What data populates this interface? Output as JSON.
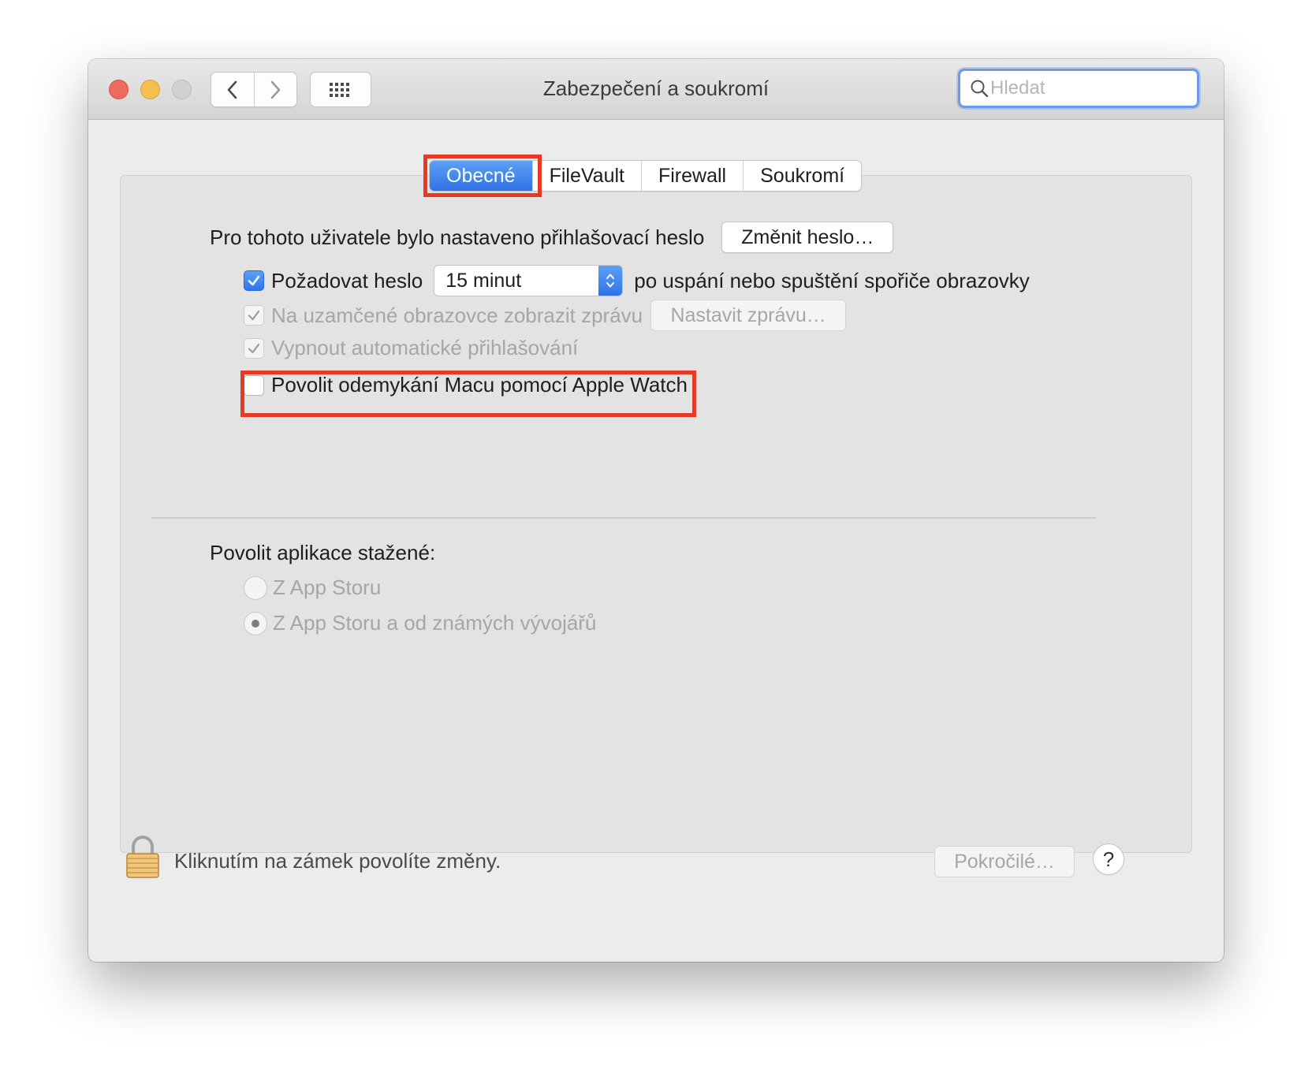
{
  "window": {
    "title": "Zabezpečení a soukromí",
    "icons": {
      "close": "close-window-icon",
      "minimize": "minimize-window-icon",
      "zoom": "zoom-window-icon",
      "back": "chevron-left-icon",
      "forward": "chevron-right-icon",
      "show_all": "grid-icon",
      "search": "search-icon"
    }
  },
  "search": {
    "placeholder": "Hledat",
    "value": ""
  },
  "tabs": [
    {
      "label": "Obecné",
      "selected": true
    },
    {
      "label": "FileVault",
      "selected": false
    },
    {
      "label": "Firewall",
      "selected": false
    },
    {
      "label": "Soukromí",
      "selected": false
    }
  ],
  "general": {
    "password_set_text": "Pro tohoto uživatele bylo nastaveno přihlašovací heslo",
    "change_password_button": "Změnit heslo…",
    "require_password": {
      "label": "Požadovat heslo",
      "checked": true,
      "delay_value": "15 minut",
      "suffix": "po uspání nebo spuštění spořiče obrazovky"
    },
    "lock_message": {
      "label": "Na uzamčené obrazovce zobrazit zprávu",
      "checked": true,
      "enabled": false,
      "button": "Nastavit zprávu…"
    },
    "auto_login": {
      "label": "Vypnout automatické přihlašování",
      "checked": true,
      "enabled": false
    },
    "apple_watch": {
      "label": "Povolit odemykání Macu pomocí Apple Watch",
      "checked": false
    }
  },
  "downloads": {
    "title": "Povolit aplikace stažené:",
    "options": [
      {
        "label": "Z App Storu",
        "selected": false
      },
      {
        "label": "Z App Storu a od známých vývojářů",
        "selected": true
      }
    ]
  },
  "footer": {
    "lock_text": "Kliknutím na zámek povolíte změny.",
    "lock_icon": "padlock-icon",
    "advanced_button": "Pokročilé…",
    "help_button": "?"
  },
  "colors": {
    "accent": "#2f74e8",
    "highlight_frame": "#e53a26",
    "close": "#ed6a5e",
    "minimize": "#f5bf4f"
  }
}
